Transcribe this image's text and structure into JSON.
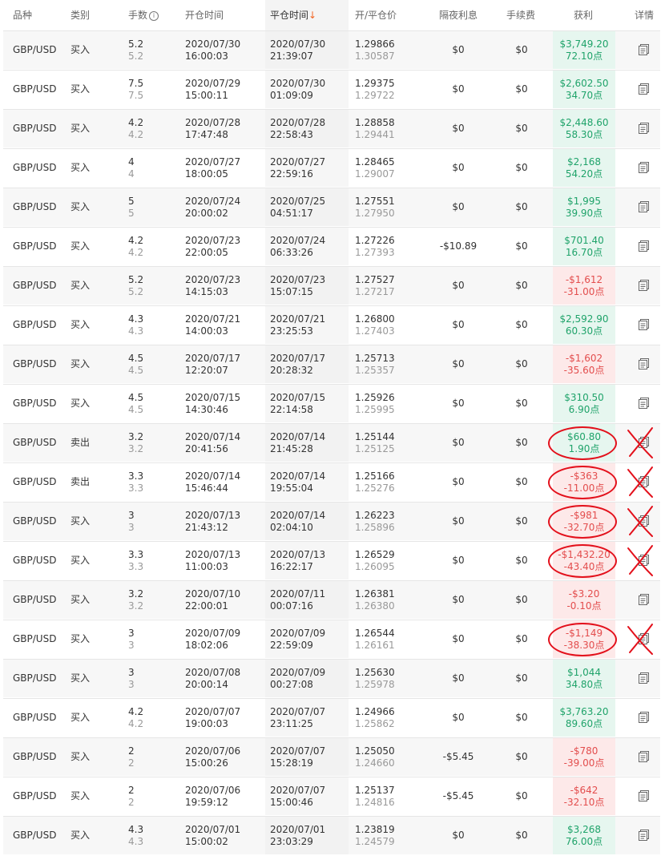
{
  "header": {
    "product": "品种",
    "type": "类别",
    "lots": "手数",
    "open_time": "开仓时间",
    "close_time": "平仓时间",
    "sort_arrow": "↓",
    "price": "开/平仓价",
    "swap": "隔夜利息",
    "fee": "手续费",
    "profit": "获利",
    "detail": "详情"
  },
  "colors": {
    "positive": "#1fa36a",
    "negative": "#e34d4d",
    "annotation": "#e3101b",
    "sort_arrow": "#f26522"
  },
  "rows": [
    {
      "product": "GBP/USD",
      "type": "买入",
      "lots": "5.2",
      "lots2": "5.2",
      "open_date": "2020/07/30",
      "open_time": "16:00:03",
      "close_date": "2020/07/30",
      "close_time": "21:39:07",
      "open_price": "1.29866",
      "close_price": "1.30587",
      "swap": "$0",
      "fee": "$0",
      "profit": "$3,749.20",
      "points": "72.10点",
      "sign": "pos",
      "circled": false
    },
    {
      "product": "GBP/USD",
      "type": "买入",
      "lots": "7.5",
      "lots2": "7.5",
      "open_date": "2020/07/29",
      "open_time": "15:00:11",
      "close_date": "2020/07/30",
      "close_time": "01:09:09",
      "open_price": "1.29375",
      "close_price": "1.29722",
      "swap": "$0",
      "fee": "$0",
      "profit": "$2,602.50",
      "points": "34.70点",
      "sign": "pos",
      "circled": false
    },
    {
      "product": "GBP/USD",
      "type": "买入",
      "lots": "4.2",
      "lots2": "4.2",
      "open_date": "2020/07/28",
      "open_time": "17:47:48",
      "close_date": "2020/07/28",
      "close_time": "22:58:43",
      "open_price": "1.28858",
      "close_price": "1.29441",
      "swap": "$0",
      "fee": "$0",
      "profit": "$2,448.60",
      "points": "58.30点",
      "sign": "pos",
      "circled": false
    },
    {
      "product": "GBP/USD",
      "type": "买入",
      "lots": "4",
      "lots2": "4",
      "open_date": "2020/07/27",
      "open_time": "18:00:05",
      "close_date": "2020/07/27",
      "close_time": "22:59:16",
      "open_price": "1.28465",
      "close_price": "1.29007",
      "swap": "$0",
      "fee": "$0",
      "profit": "$2,168",
      "points": "54.20点",
      "sign": "pos",
      "circled": false
    },
    {
      "product": "GBP/USD",
      "type": "买入",
      "lots": "5",
      "lots2": "5",
      "open_date": "2020/07/24",
      "open_time": "20:00:02",
      "close_date": "2020/07/25",
      "close_time": "04:51:17",
      "open_price": "1.27551",
      "close_price": "1.27950",
      "swap": "$0",
      "fee": "$0",
      "profit": "$1,995",
      "points": "39.90点",
      "sign": "pos",
      "circled": false
    },
    {
      "product": "GBP/USD",
      "type": "买入",
      "lots": "4.2",
      "lots2": "4.2",
      "open_date": "2020/07/23",
      "open_time": "22:00:05",
      "close_date": "2020/07/24",
      "close_time": "06:33:26",
      "open_price": "1.27226",
      "close_price": "1.27393",
      "swap": "-$10.89",
      "fee": "$0",
      "profit": "$701.40",
      "points": "16.70点",
      "sign": "pos",
      "circled": false
    },
    {
      "product": "GBP/USD",
      "type": "买入",
      "lots": "5.2",
      "lots2": "5.2",
      "open_date": "2020/07/23",
      "open_time": "14:15:03",
      "close_date": "2020/07/23",
      "close_time": "15:07:15",
      "open_price": "1.27527",
      "close_price": "1.27217",
      "swap": "$0",
      "fee": "$0",
      "profit": "-$1,612",
      "points": "-31.00点",
      "sign": "neg",
      "circled": false
    },
    {
      "product": "GBP/USD",
      "type": "买入",
      "lots": "4.3",
      "lots2": "4.3",
      "open_date": "2020/07/21",
      "open_time": "14:00:03",
      "close_date": "2020/07/21",
      "close_time": "23:25:53",
      "open_price": "1.26800",
      "close_price": "1.27403",
      "swap": "$0",
      "fee": "$0",
      "profit": "$2,592.90",
      "points": "60.30点",
      "sign": "pos",
      "circled": false
    },
    {
      "product": "GBP/USD",
      "type": "买入",
      "lots": "4.5",
      "lots2": "4.5",
      "open_date": "2020/07/17",
      "open_time": "12:20:07",
      "close_date": "2020/07/17",
      "close_time": "20:28:32",
      "open_price": "1.25713",
      "close_price": "1.25357",
      "swap": "$0",
      "fee": "$0",
      "profit": "-$1,602",
      "points": "-35.60点",
      "sign": "neg",
      "circled": false
    },
    {
      "product": "GBP/USD",
      "type": "买入",
      "lots": "4.5",
      "lots2": "4.5",
      "open_date": "2020/07/15",
      "open_time": "14:30:46",
      "close_date": "2020/07/15",
      "close_time": "22:14:58",
      "open_price": "1.25926",
      "close_price": "1.25995",
      "swap": "$0",
      "fee": "$0",
      "profit": "$310.50",
      "points": "6.90点",
      "sign": "pos",
      "circled": false
    },
    {
      "product": "GBP/USD",
      "type": "卖出",
      "lots": "3.2",
      "lots2": "3.2",
      "open_date": "2020/07/14",
      "open_time": "20:41:56",
      "close_date": "2020/07/14",
      "close_time": "21:45:28",
      "open_price": "1.25144",
      "close_price": "1.25125",
      "swap": "$0",
      "fee": "$0",
      "profit": "$60.80",
      "points": "1.90点",
      "sign": "pos",
      "circled": true
    },
    {
      "product": "GBP/USD",
      "type": "卖出",
      "lots": "3.3",
      "lots2": "3.3",
      "open_date": "2020/07/14",
      "open_time": "15:46:44",
      "close_date": "2020/07/14",
      "close_time": "19:55:04",
      "open_price": "1.25166",
      "close_price": "1.25276",
      "swap": "$0",
      "fee": "$0",
      "profit": "-$363",
      "points": "-11.00点",
      "sign": "neg",
      "circled": true
    },
    {
      "product": "GBP/USD",
      "type": "买入",
      "lots": "3",
      "lots2": "3",
      "open_date": "2020/07/13",
      "open_time": "21:43:12",
      "close_date": "2020/07/14",
      "close_time": "02:04:10",
      "open_price": "1.26223",
      "close_price": "1.25896",
      "swap": "$0",
      "fee": "$0",
      "profit": "-$981",
      "points": "-32.70点",
      "sign": "neg",
      "circled": true
    },
    {
      "product": "GBP/USD",
      "type": "买入",
      "lots": "3.3",
      "lots2": "3.3",
      "open_date": "2020/07/13",
      "open_time": "11:00:03",
      "close_date": "2020/07/13",
      "close_time": "16:22:17",
      "open_price": "1.26529",
      "close_price": "1.26095",
      "swap": "$0",
      "fee": "$0",
      "profit": "-$1,432.20",
      "points": "-43.40点",
      "sign": "neg",
      "circled": true
    },
    {
      "product": "GBP/USD",
      "type": "买入",
      "lots": "3.2",
      "lots2": "3.2",
      "open_date": "2020/07/10",
      "open_time": "22:00:01",
      "close_date": "2020/07/11",
      "close_time": "00:07:16",
      "open_price": "1.26381",
      "close_price": "1.26380",
      "swap": "$0",
      "fee": "$0",
      "profit": "-$3.20",
      "points": "-0.10点",
      "sign": "neg",
      "circled": false
    },
    {
      "product": "GBP/USD",
      "type": "买入",
      "lots": "3",
      "lots2": "3",
      "open_date": "2020/07/09",
      "open_time": "18:02:06",
      "close_date": "2020/07/09",
      "close_time": "22:59:09",
      "open_price": "1.26544",
      "close_price": "1.26161",
      "swap": "$0",
      "fee": "$0",
      "profit": "-$1,149",
      "points": "-38.30点",
      "sign": "neg",
      "circled": true
    },
    {
      "product": "GBP/USD",
      "type": "买入",
      "lots": "3",
      "lots2": "3",
      "open_date": "2020/07/08",
      "open_time": "20:00:14",
      "close_date": "2020/07/09",
      "close_time": "00:27:08",
      "open_price": "1.25630",
      "close_price": "1.25978",
      "swap": "$0",
      "fee": "$0",
      "profit": "$1,044",
      "points": "34.80点",
      "sign": "pos",
      "circled": false
    },
    {
      "product": "GBP/USD",
      "type": "买入",
      "lots": "4.2",
      "lots2": "4.2",
      "open_date": "2020/07/07",
      "open_time": "19:00:03",
      "close_date": "2020/07/07",
      "close_time": "23:11:25",
      "open_price": "1.24966",
      "close_price": "1.25862",
      "swap": "$0",
      "fee": "$0",
      "profit": "$3,763.20",
      "points": "89.60点",
      "sign": "pos",
      "circled": false
    },
    {
      "product": "GBP/USD",
      "type": "买入",
      "lots": "2",
      "lots2": "2",
      "open_date": "2020/07/06",
      "open_time": "15:00:26",
      "close_date": "2020/07/07",
      "close_time": "15:28:19",
      "open_price": "1.25050",
      "close_price": "1.24660",
      "swap": "-$5.45",
      "fee": "$0",
      "profit": "-$780",
      "points": "-39.00点",
      "sign": "neg",
      "circled": false
    },
    {
      "product": "GBP/USD",
      "type": "买入",
      "lots": "2",
      "lots2": "2",
      "open_date": "2020/07/06",
      "open_time": "19:59:12",
      "close_date": "2020/07/07",
      "close_time": "15:00:46",
      "open_price": "1.25137",
      "close_price": "1.24816",
      "swap": "-$5.45",
      "fee": "$0",
      "profit": "-$642",
      "points": "-32.10点",
      "sign": "neg",
      "circled": false
    },
    {
      "product": "GBP/USD",
      "type": "买入",
      "lots": "4.3",
      "lots2": "4.3",
      "open_date": "2020/07/01",
      "open_time": "15:00:02",
      "close_date": "2020/07/01",
      "close_time": "23:03:29",
      "open_price": "1.23819",
      "close_price": "1.24579",
      "swap": "$0",
      "fee": "$0",
      "profit": "$3,268",
      "points": "76.00点",
      "sign": "pos",
      "circled": false
    }
  ]
}
